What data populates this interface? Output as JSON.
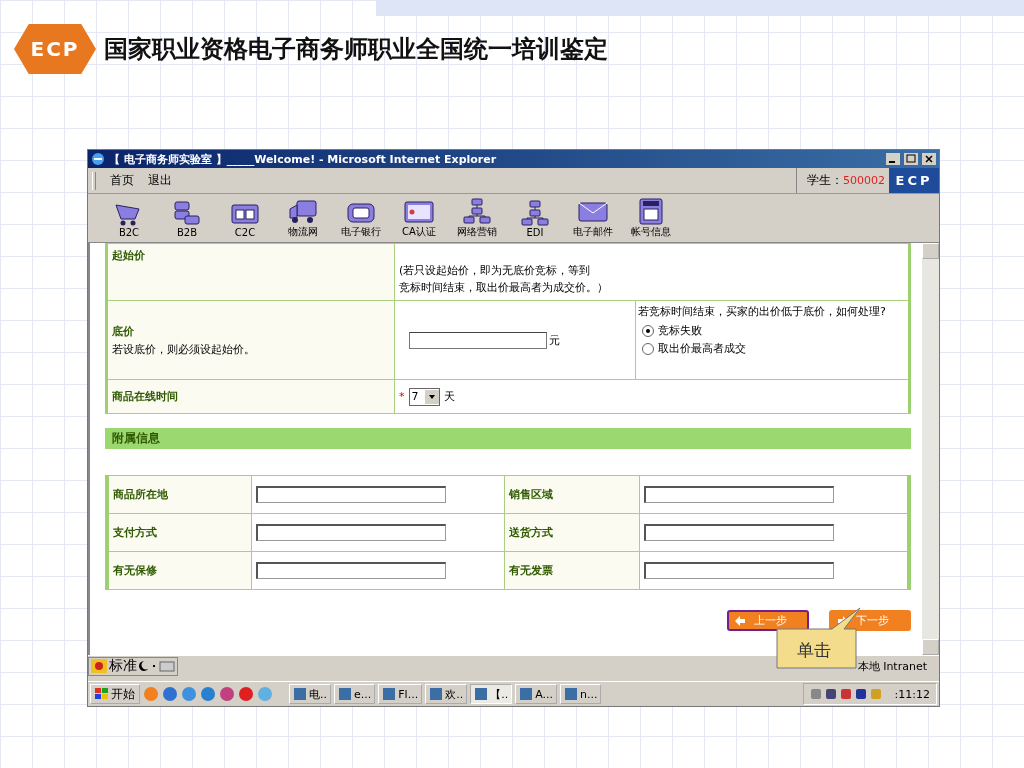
{
  "slide": {
    "logo": "ECP",
    "title": "国家职业资格电子商务师职业全国统一培训鉴定"
  },
  "window": {
    "title": "【 电子商务师实验室 】_____Welcome! - Microsoft Internet Explorer"
  },
  "menu": [
    "首页",
    "退出"
  ],
  "student": {
    "label": "学生：",
    "id": "500002"
  },
  "brand": "ECP",
  "toolbar": [
    "B2C",
    "B2B",
    "C2C",
    "物流网",
    "电子银行",
    "CA认证",
    "网络营销",
    "EDI",
    "电子邮件",
    "帐号信息"
  ],
  "form": {
    "start_price": {
      "label": "起始价",
      "note_lines": [
        "(若只设起始价，即为无底价竞标，等到",
        "竞标时间结束，取出价最高者为成交价。）"
      ]
    },
    "reserve": {
      "label": "底价",
      "hint": "若设底价，则必须设起始价。",
      "unit": "元",
      "question": "若竞标时间结束，买家的出价低于底价，如何处理?",
      "options": [
        {
          "label": "竞标失败",
          "selected": true
        },
        {
          "label": "取出价最高者成交",
          "selected": false
        }
      ]
    },
    "duration": {
      "label": "商品在线时间",
      "required": "*",
      "value": "7",
      "unit": "天"
    }
  },
  "section": "附属信息",
  "extra_fields": [
    {
      "label": "商品所在地"
    },
    {
      "label": "销售区域"
    },
    {
      "label": "支付方式"
    },
    {
      "label": "送货方式"
    },
    {
      "label": "有无保修"
    },
    {
      "label": "有无发票"
    }
  ],
  "buttons": [
    {
      "label": "上一步",
      "focused": true
    },
    {
      "label": "下一步",
      "focused": false
    }
  ],
  "callout": "单击",
  "ime": {
    "mode": "标准"
  },
  "status": "本地 Intranet",
  "taskbar": {
    "start": "开始",
    "tasks": [
      {
        "label": "电..",
        "selected": false
      },
      {
        "label": "e...",
        "selected": false
      },
      {
        "label": "Fl...",
        "selected": false
      },
      {
        "label": "欢..",
        "selected": false
      },
      {
        "label": "【..",
        "selected": true
      },
      {
        "label": "A...",
        "selected": false
      },
      {
        "label": "n...",
        "selected": false
      }
    ],
    "clock": ":11:12"
  }
}
